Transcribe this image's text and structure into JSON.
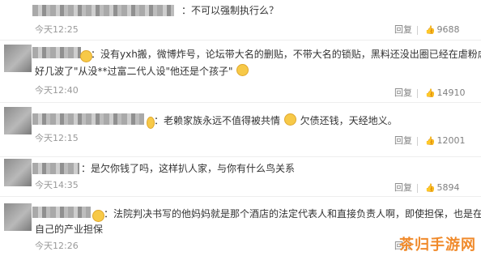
{
  "comments": [
    {
      "lines": [
        "：不可以强制执行么？"
      ],
      "time": "今天12:25",
      "reply": "回复",
      "likes": "9688"
    },
    {
      "lines": [
        "：没有yxh搬，微博炸号，论坛带大名的删贴，不带大名的锁贴，黑料还没出圈已经在虐粉虐了",
        "好几波了\"从没**过富二代人设\"他还是个孩子\""
      ],
      "time": "今天12:40",
      "reply": "回复",
      "likes": "14910"
    },
    {
      "lines": [
        "：老赖家族永远不值得被共情",
        "欠债还钱，天经地义。"
      ],
      "time": "今天12:15",
      "reply": "回复",
      "likes": "12001"
    },
    {
      "lines": [
        "：是欠你钱了吗，这样扒人家，与你有什么鸟关系"
      ],
      "time": "今天14:35",
      "reply": "回复",
      "likes": "5894"
    },
    {
      "lines": [
        "：法院判决书写的他妈妈就是那个酒店的法定代表人和直接负责人啊，即使担保，也是在给",
        "自己的产业担保"
      ],
      "time": "今天12:26",
      "reply": "回复",
      "likes": ""
    }
  ],
  "icons": {
    "like": "thumbs-up-icon",
    "emoji": "smiley-emoji-icon"
  },
  "watermark": "茶归手游网",
  "colors": {
    "watermark": "#f08a2b",
    "meta": "#999999"
  }
}
